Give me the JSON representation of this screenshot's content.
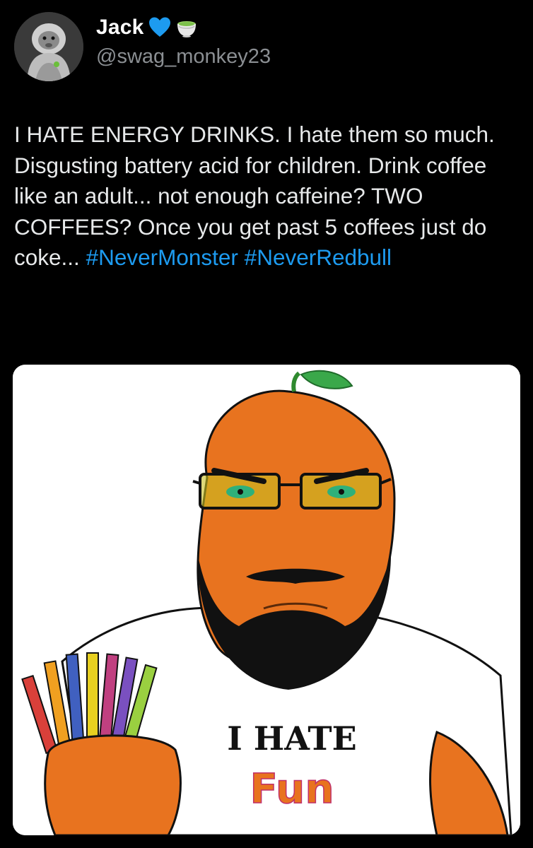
{
  "author": {
    "display_name": "Jack",
    "handle": "@swag_monkey23",
    "badges": [
      "blue-heart-icon",
      "matcha-tea-icon"
    ]
  },
  "tweet": {
    "text_parts": [
      "I HATE ENERGY DRINKS. I hate them so much. Disgusting battery acid for children. Drink coffee like an adult... not enough caffeine? TWO COFFEES? Once you get past 5 coffees just do coke..."
    ],
    "hashtags": [
      "#NeverMonster",
      "#NeverRedbull"
    ]
  },
  "media": {
    "shirt_line1": "I HATE",
    "shirt_line2": "Fun"
  },
  "colors": {
    "background": "#000000",
    "text": "#e7e9ea",
    "secondary_text": "#8b8f93",
    "hashtag": "#1d9bf0",
    "heart": "#1d9bf0",
    "face_orange": "#e8731f"
  }
}
